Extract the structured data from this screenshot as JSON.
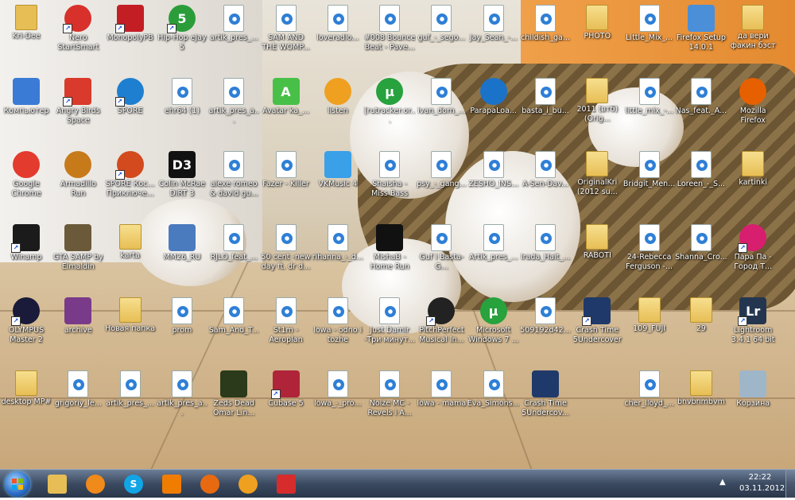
{
  "desktop": {
    "icons": [
      {
        "label": "Kri-Dee",
        "kind": "folder",
        "color": "#e7be55",
        "shortcut": false
      },
      {
        "label": "Nero StartSmart",
        "kind": "round",
        "color": "#d8302b",
        "shortcut": true
      },
      {
        "label": "MonopolyPB",
        "kind": "square",
        "color": "#c41e25",
        "shortcut": true
      },
      {
        "label": "Hip-Hop eJay 5",
        "kind": "round",
        "color": "#2a9d3a",
        "glyph": "5",
        "shortcut": true
      },
      {
        "label": "artik_pres_...",
        "kind": "file",
        "shortcut": false
      },
      {
        "label": "SAM AND THE WOMP...",
        "kind": "file",
        "shortcut": false
      },
      {
        "label": "loveradio...",
        "kind": "file",
        "shortcut": false
      },
      {
        "label": "#008 Bounce Beat - Pave...",
        "kind": "file",
        "shortcut": false
      },
      {
        "label": "guf_-_sego...",
        "kind": "file",
        "shortcut": false
      },
      {
        "label": "Jay_Sean_-...",
        "kind": "file",
        "shortcut": false
      },
      {
        "label": "childish_ga...",
        "kind": "file",
        "shortcut": false
      },
      {
        "label": "PHOTO",
        "kind": "folder",
        "shortcut": false
      },
      {
        "label": "Little_Mix_...",
        "kind": "file",
        "shortcut": false
      },
      {
        "label": "Firefox Setup 14.0.1",
        "kind": "square",
        "color": "#4a8fd8",
        "shortcut": false
      },
      {
        "label": "да вери факин бэст",
        "kind": "folder",
        "shortcut": false
      },
      {
        "label": "Компьютер",
        "kind": "square",
        "color": "#3a7bd5",
        "shortcut": false
      },
      {
        "label": "Angry Birds Space",
        "kind": "square",
        "color": "#d93a2b",
        "shortcut": true
      },
      {
        "label": "SPORE",
        "kind": "round",
        "color": "#1e7fd0",
        "shortcut": true
      },
      {
        "label": "ehr64 (1)",
        "kind": "file",
        "shortcut": false
      },
      {
        "label": "artik_pres_a...",
        "kind": "file",
        "shortcut": false
      },
      {
        "label": "Avatar ka_...",
        "kind": "square",
        "color": "#48c048",
        "glyph": "A",
        "shortcut": false
      },
      {
        "label": "listen",
        "kind": "round",
        "color": "#f0a020",
        "shortcut": false
      },
      {
        "label": "[rutracker.or...",
        "kind": "round",
        "color": "#27a23d",
        "glyph": "µ",
        "shortcut": false
      },
      {
        "label": "ivan_dorn_...",
        "kind": "file",
        "shortcut": false
      },
      {
        "label": "ParapaLoa...",
        "kind": "round",
        "color": "#1a73c9",
        "shortcut": false
      },
      {
        "label": "basta_i_bu...",
        "kind": "file",
        "shortcut": false
      },
      {
        "label": "2011 (втб) (Orig...",
        "kind": "folder",
        "shortcut": false
      },
      {
        "label": "little_mix_-...",
        "kind": "file",
        "shortcut": false
      },
      {
        "label": "Nas_feat._A...",
        "kind": "file",
        "shortcut": false
      },
      {
        "label": "Mozilla Firefox",
        "kind": "round",
        "color": "#e66000",
        "shortcut": false
      },
      {
        "label": "Google Chrome",
        "kind": "round",
        "color": "#e33b2e",
        "shortcut": false
      },
      {
        "label": "Armadillo Run",
        "kind": "round",
        "color": "#c77a1a",
        "shortcut": false
      },
      {
        "label": "SPORE Кос... Приключе...",
        "kind": "round",
        "color": "#d24a1e",
        "shortcut": true
      },
      {
        "label": "Colin McRae DiRT 3",
        "kind": "square",
        "color": "#111111",
        "glyph": "D3",
        "shortcut": false
      },
      {
        "label": "alexe romeo & david gu...",
        "kind": "file",
        "shortcut": false
      },
      {
        "label": "Fazer - Killer",
        "kind": "file",
        "shortcut": false
      },
      {
        "label": "VKMusic 4",
        "kind": "square",
        "color": "#3aa0e8",
        "shortcut": false
      },
      {
        "label": "Shaisha - Miss Bass",
        "kind": "file",
        "shortcut": false
      },
      {
        "label": "psy_-_gang...",
        "kind": "file",
        "shortcut": false
      },
      {
        "label": "ZESHO_INS...",
        "kind": "file",
        "shortcut": false
      },
      {
        "label": "A-Sen-Dav...",
        "kind": "file",
        "shortcut": false
      },
      {
        "label": "OriginalKri (2012 su...",
        "kind": "folder",
        "shortcut": false
      },
      {
        "label": "Bridgit_Men...",
        "kind": "file",
        "shortcut": false
      },
      {
        "label": "Loreen_-_S...",
        "kind": "file",
        "shortcut": false
      },
      {
        "label": "kartinki",
        "kind": "folder",
        "shortcut": false
      },
      {
        "label": "Winamp",
        "kind": "square",
        "color": "#1b1b1b",
        "shortcut": true
      },
      {
        "label": "GTA SAMP by Elmaldin",
        "kind": "square",
        "color": "#6b5a3a",
        "shortcut": false
      },
      {
        "label": "karta",
        "kind": "folder",
        "shortcut": false
      },
      {
        "label": "MM26_RU",
        "kind": "square",
        "color": "#4b7bbf",
        "shortcut": false
      },
      {
        "label": "RJLO_feat_...",
        "kind": "file",
        "shortcut": false
      },
      {
        "label": "50 cent -new day ft. dr d...",
        "kind": "file",
        "shortcut": false
      },
      {
        "label": "rihanna_-_d...",
        "kind": "file",
        "shortcut": false
      },
      {
        "label": "MishaB -Home Run",
        "kind": "square",
        "color": "#111111",
        "shortcut": false
      },
      {
        "label": "Guf i Basta-G...",
        "kind": "file",
        "shortcut": false
      },
      {
        "label": "Artik_pres_...",
        "kind": "file",
        "shortcut": false
      },
      {
        "label": "Irada_Hait_...",
        "kind": "file",
        "shortcut": false
      },
      {
        "label": "RABOTI",
        "kind": "folder",
        "shortcut": false
      },
      {
        "label": "24-Rebecca Ferguson -...",
        "kind": "file",
        "shortcut": false
      },
      {
        "label": "Shanna_Cro...",
        "kind": "file",
        "shortcut": false
      },
      {
        "label": "Пара Па - Город Т...",
        "kind": "round",
        "color": "#d81e6e",
        "shortcut": true
      },
      {
        "label": "OLYMPUS Master 2",
        "kind": "round",
        "color": "#1a1a3a",
        "shortcut": true
      },
      {
        "label": "archive",
        "kind": "square",
        "color": "#7a3a8a",
        "shortcut": false
      },
      {
        "label": "Новая папка",
        "kind": "folder",
        "shortcut": false
      },
      {
        "label": "prom",
        "kind": "file",
        "shortcut": false
      },
      {
        "label": "Sam_And_T...",
        "kind": "file",
        "shortcut": false
      },
      {
        "label": "St1m - Aeroplan",
        "kind": "file",
        "shortcut": false
      },
      {
        "label": "lowa - odno i tozhe",
        "kind": "file",
        "shortcut": false
      },
      {
        "label": "Just Damir -Три минут...",
        "kind": "file",
        "shortcut": false
      },
      {
        "label": "PitchPerfect Musical In...",
        "kind": "round",
        "color": "#222222",
        "shortcut": true
      },
      {
        "label": "Microsoft Windows 7 ...",
        "kind": "round",
        "color": "#27a23d",
        "glyph": "µ",
        "shortcut": false
      },
      {
        "label": "509192d42...",
        "kind": "file",
        "shortcut": false
      },
      {
        "label": "Crash Time 5Undercover",
        "kind": "square",
        "color": "#1f3a6a",
        "shortcut": true
      },
      {
        "label": "109_FUJI",
        "kind": "folder",
        "shortcut": false
      },
      {
        "label": "29",
        "kind": "folder",
        "shortcut": false
      },
      {
        "label": "Lightroom 3.4.1 64 bit",
        "kind": "square",
        "color": "#24364f",
        "glyph": "Lr",
        "shortcut": true
      },
      {
        "label": "desktop MP#",
        "kind": "folder",
        "shortcut": false
      },
      {
        "label": "grigoriy_le...",
        "kind": "file",
        "shortcut": false
      },
      {
        "label": "artik_pres_...",
        "kind": "file",
        "shortcut": false
      },
      {
        "label": "artik_pres_a...",
        "kind": "file",
        "shortcut": false
      },
      {
        "label": "Zeds Dead Omar Lin...",
        "kind": "square",
        "color": "#2a3a1a",
        "shortcut": false
      },
      {
        "label": "Cubase 5",
        "kind": "square",
        "color": "#b0243a",
        "shortcut": true
      },
      {
        "label": "lowa_-_pro...",
        "kind": "file",
        "shortcut": false
      },
      {
        "label": "Noize MC -Revels i A...",
        "kind": "file",
        "shortcut": false
      },
      {
        "label": "lowa - mama",
        "kind": "file",
        "shortcut": false
      },
      {
        "label": "Eva_Simons...",
        "kind": "file",
        "shortcut": false
      },
      {
        "label": "Crash Time 5Undercov...",
        "kind": "square",
        "color": "#1f3a6a",
        "shortcut": false
      },
      {
        "label": "cher_lloyd_...",
        "kind": "file",
        "shortcut": false
      },
      {
        "label": "bnvbnmbvm",
        "kind": "folder",
        "shortcut": false
      },
      {
        "label": "Корзина",
        "kind": "square",
        "color": "#9fb6c9",
        "shortcut": false
      }
    ]
  },
  "taskbar": {
    "apps": [
      {
        "name": "explorer",
        "color": "#e7be55"
      },
      {
        "name": "media-player",
        "color": "#f08a1a"
      },
      {
        "name": "skype",
        "color": "#12a5e6",
        "glyph": "S"
      },
      {
        "name": "vlc",
        "color": "#f07d00"
      },
      {
        "name": "reason",
        "color": "#e86a10"
      },
      {
        "name": "winamp",
        "color": "#f0a020"
      },
      {
        "name": "paint",
        "color": "#d62c2c"
      }
    ],
    "clock": {
      "time": "22:22",
      "date": "03.11.2012"
    },
    "tray_arrow": "▲"
  }
}
